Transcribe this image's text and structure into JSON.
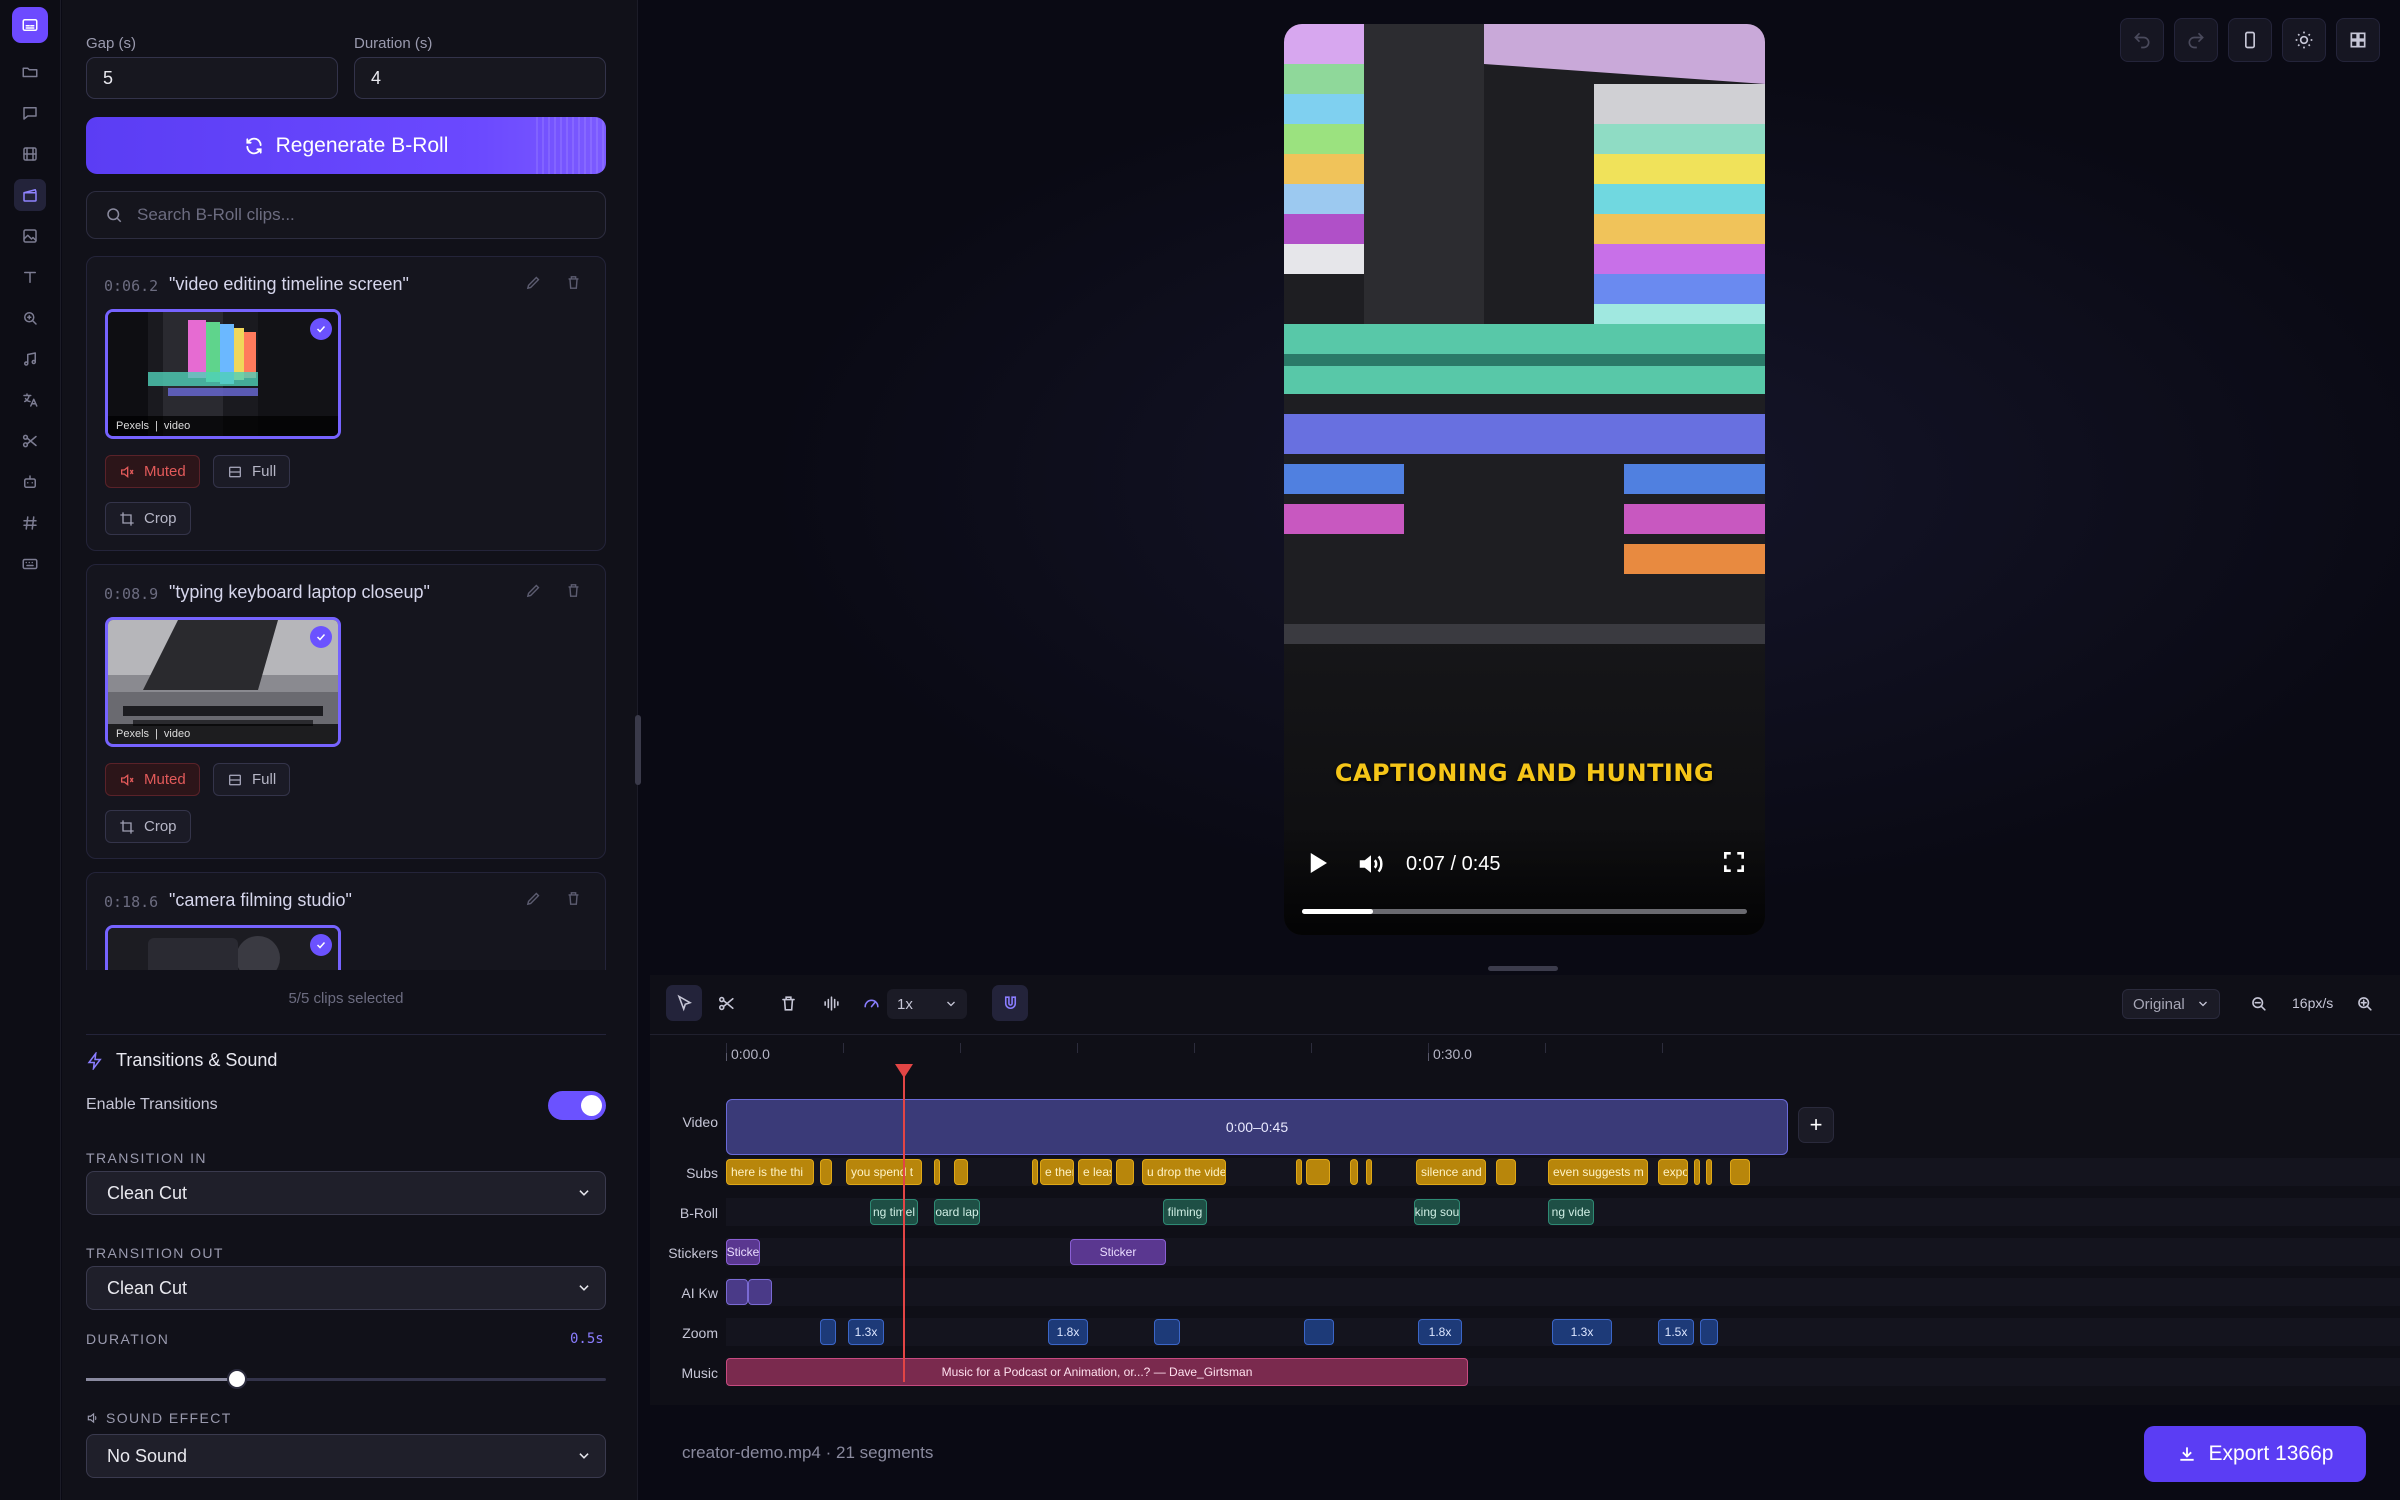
{
  "left_panel": {
    "gap_label": "Gap (s)",
    "gap_value": "5",
    "duration_label": "Duration (s)",
    "duration_value": "4",
    "regenerate_label": "Regenerate B-Roll",
    "search_placeholder": "Search B-Roll clips...",
    "clips": [
      {
        "time": "0:06.2",
        "query": "\"video editing timeline screen\"",
        "source": "Pexels",
        "kind": "video",
        "muted_label": "Muted",
        "full_label": "Full",
        "crop_label": "Crop"
      },
      {
        "time": "0:08.9",
        "query": "\"typing keyboard laptop closeup\"",
        "source": "Pexels",
        "kind": "video",
        "muted_label": "Muted",
        "full_label": "Full",
        "crop_label": "Crop"
      },
      {
        "time": "0:18.6",
        "query": "\"camera filming studio\""
      }
    ],
    "selected_count": "5/5 clips selected",
    "transitions": {
      "heading": "Transitions & Sound",
      "enable_label": "Enable Transitions",
      "enabled": true,
      "in_label": "TRANSITION IN",
      "in_value": "Clean Cut",
      "out_label": "TRANSITION OUT",
      "out_value": "Clean Cut",
      "duration_label": "DURATION",
      "duration_value": "0.5s",
      "duration_fraction": 0.29,
      "sound_label": "SOUND EFFECT",
      "sound_value": "No Sound"
    }
  },
  "preview": {
    "caption": "CAPTIONING AND HUNTING",
    "time": "0:07 / 0:45",
    "progress": 0.16
  },
  "timeline": {
    "speed": "1x",
    "aspect": "Original",
    "zoom_level": "16px/s",
    "ruler": [
      "0:00.0",
      "0:30.0"
    ],
    "tracks": {
      "video": "Video",
      "subs": "Subs",
      "broll": "B-Roll",
      "stickers": "Stickers",
      "aikw": "AI Kw",
      "zoom": "Zoom",
      "music": "Music"
    },
    "video_clip": "0:00–0:45",
    "subs_texts": [
      "here is the thi",
      "you spend t",
      "e ther",
      "e leas",
      "u drop the vide",
      "silence and",
      "even suggests m",
      "expo"
    ],
    "broll_texts": [
      "ng timel",
      "oard lap",
      "filming",
      "king sou",
      "ng vide"
    ],
    "sticker_texts": [
      "Sticke",
      "Sticker"
    ],
    "zoom_texts": [
      "1.3x",
      "1.8x",
      "1.8x",
      "1.3x",
      "1.5x"
    ],
    "music_text": "Music for a Podcast or Animation, or...? — Dave_Girtsman"
  },
  "footer": {
    "filename": "creator-demo.mp4",
    "segments": "21 segments",
    "export_label": "Export 1366p"
  },
  "colors": {
    "accent": "#6b52ff",
    "caption": "#f5c518",
    "playhead": "#e24545"
  }
}
